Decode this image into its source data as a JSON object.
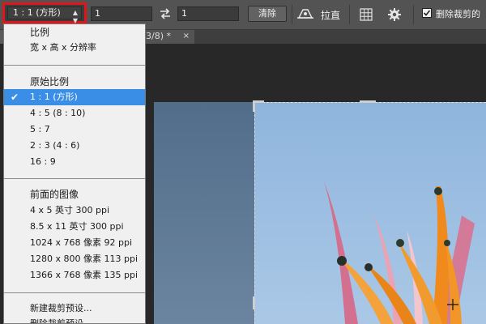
{
  "options_bar": {
    "ratio_preset": "1 : 1 (方形)",
    "width_value": "1",
    "height_value": "1",
    "clear_label": "清除",
    "straighten_label": "拉直",
    "delete_cropped_label": "删除裁剪的"
  },
  "document_tab": {
    "title": "3/8) *",
    "close": "×"
  },
  "menu": {
    "sections": [
      {
        "items": [
          "比例",
          "宽 x 高 x 分辨率"
        ]
      },
      {
        "items": [
          "原始比例",
          "1 : 1 (方形)",
          "4 : 5 (8 : 10)",
          "5 : 7",
          "2 : 3 (4 : 6)",
          "16 : 9"
        ]
      },
      {
        "items": [
          "前面的图像",
          "4 x 5 英寸 300 ppi",
          "8.5 x 11 英寸 300 ppi",
          "1024 x 768 像素 92 ppi",
          "1280 x 800 像素 113 ppi",
          "1366 x 768 像素 135 ppi"
        ]
      },
      {
        "items": [
          "新建裁剪预设...",
          "删除裁剪预设..."
        ]
      }
    ],
    "selected_item": "1 : 1 (方形)"
  },
  "colors": {
    "highlight": "#3a8ee6",
    "annotation_border": "#e0151b",
    "sky": "#9cc0e0",
    "petal_orange": "#f08a1c"
  },
  "icons": [
    "swap-icon",
    "straighten-icon",
    "grid-icon",
    "gear-icon",
    "checkmark-icon",
    "chevron-icon",
    "close-icon"
  ]
}
